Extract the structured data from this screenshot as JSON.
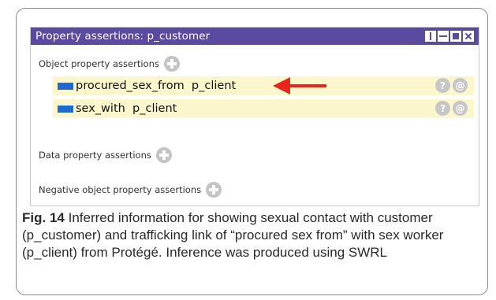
{
  "panel": {
    "title": "Property assertions: p_customer",
    "window_buttons": [
      "tile-vertical-icon",
      "tile-horizontal-icon",
      "maximize-icon",
      "close-icon"
    ]
  },
  "sections": {
    "object_property_label": "Object property assertions",
    "data_property_label": "Data property assertions",
    "negative_object_property_label": "Negative object property assertions"
  },
  "assertions": [
    {
      "property": "procured_sex_from",
      "individual": "p_client",
      "highlighted": true
    },
    {
      "property": "sex_with",
      "individual": "p_client",
      "highlighted": false
    }
  ],
  "row_buttons": {
    "explain": "?",
    "annotate": "@"
  },
  "caption": {
    "label": "Fig. 14",
    "text": "Inferred information for showing sexual contact with customer (p_customer) and trafficking link of “procured sex from” with sex worker (p_client) from Protégé. Inference was produced using SWRL"
  },
  "colors": {
    "header": "#5b4aa0",
    "row_bg": "#fbf6cc",
    "property_swatch": "#1b6bd0",
    "arrow": "#e8261c"
  }
}
